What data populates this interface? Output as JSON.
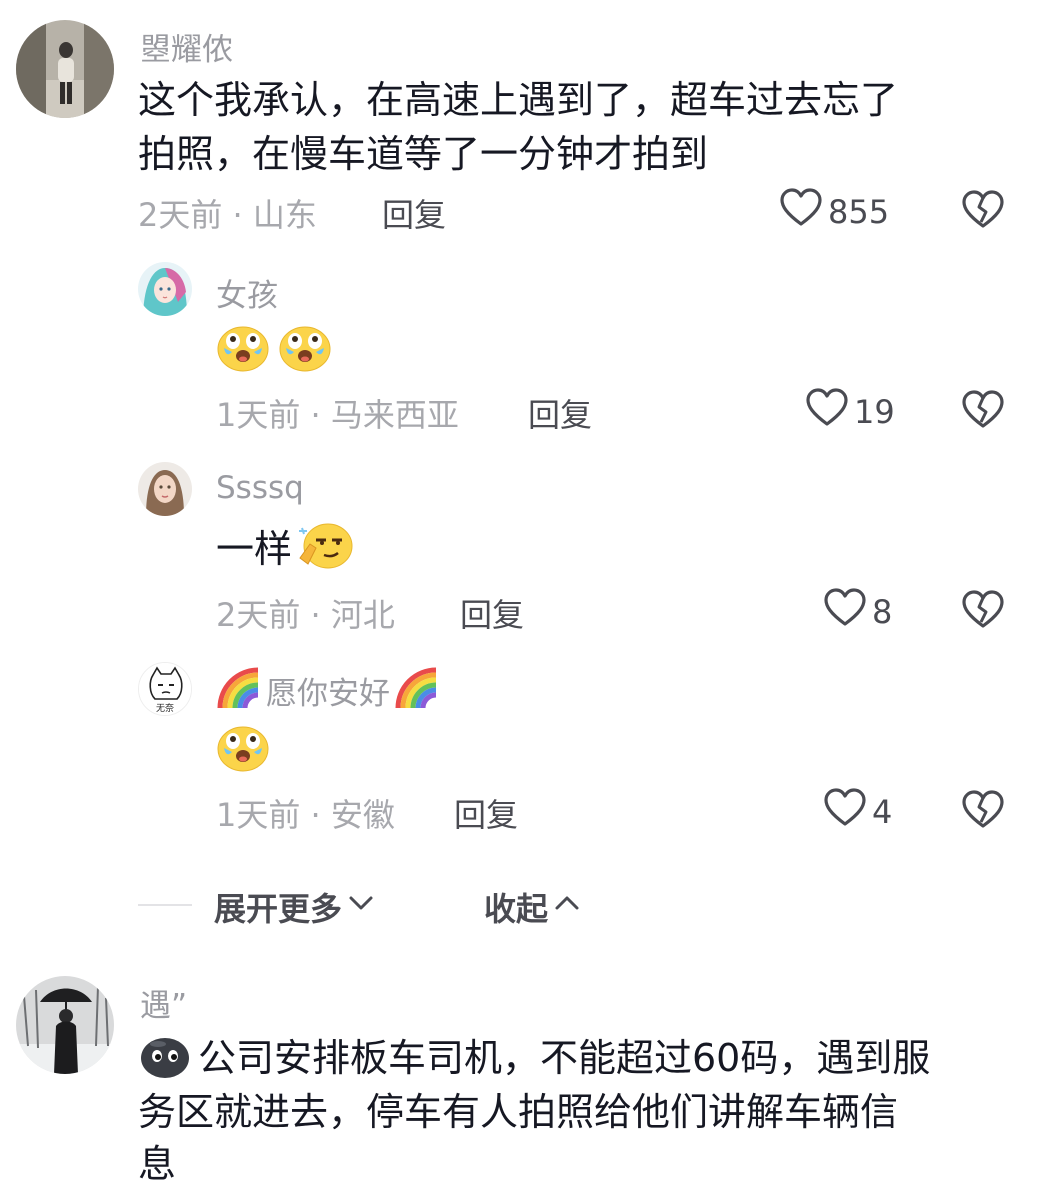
{
  "comments": [
    {
      "username": "曌耀侬",
      "text_lines": [
        "这个我承认，在高速上遇到了，超车过去忘了",
        "拍照，在慢车道等了一分钟才拍到"
      ],
      "meta": "2天前 · 山东",
      "reply_label": "回复",
      "likes": "855"
    },
    {
      "username": "女孩",
      "meta": "1天前 · 马来西亚",
      "reply_label": "回复",
      "likes": "19"
    },
    {
      "username": "Ssssq",
      "text": "一样",
      "meta": "2天前 · 河北",
      "reply_label": "回复",
      "likes": "8"
    },
    {
      "username": "愿你安好",
      "avatar_text": "无奈",
      "meta": "1天前 · 安徽",
      "reply_label": "回复",
      "likes": "4"
    },
    {
      "username": "遇”",
      "text_lines": [
        "公司安排板车司机，不能超过60码，遇到服",
        "务区就进去，停车有人拍照给他们讲解车辆信",
        "息"
      ]
    }
  ],
  "thread_controls": {
    "expand_label": "展开更多",
    "collapse_label": "收起"
  }
}
